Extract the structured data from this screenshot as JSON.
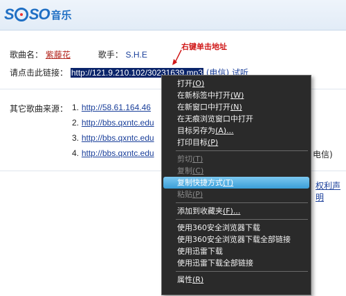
{
  "logo": {
    "brand_left": "S",
    "brand_right": "SO",
    "suffix": "音乐"
  },
  "song": {
    "name_label": "歌曲名：",
    "name": "紫藤花",
    "singer_label": "歌手：",
    "singer": "S.H.E"
  },
  "link": {
    "label": "请点击此链接：",
    "url": "http://121.9.210.102/30231639.mp3",
    "isp": "(电信)",
    "listen": "试听"
  },
  "annotation": "右键单击地址",
  "sources": {
    "label": "其它歌曲来源：",
    "items": [
      {
        "num": "1.",
        "url": "http://58.61.164.46"
      },
      {
        "num": "2.",
        "url": "http://bbs.qxntc.edu"
      },
      {
        "num": "3.",
        "url": "http://bbs.qxntc.edu"
      },
      {
        "num": "4.",
        "url": "http://bbs.qxntc.edu"
      }
    ],
    "tail": "电信)"
  },
  "footer": {
    "rights": "权利声明"
  },
  "context_menu": {
    "items": [
      {
        "label": "打开",
        "key": "(O)",
        "enabled": true
      },
      {
        "label": "在新标签中打开",
        "key": "(W)",
        "enabled": true
      },
      {
        "label": "在新窗口中打开",
        "key": "(N)",
        "enabled": true
      },
      {
        "label": "在无痕浏览窗口中打开",
        "key": "",
        "enabled": true
      },
      {
        "label": "目标另存为",
        "key": "(A)...",
        "enabled": true
      },
      {
        "label": "打印目标",
        "key": "(P)",
        "enabled": true
      },
      {
        "label": "剪切",
        "key": "(T)",
        "enabled": false
      },
      {
        "label": "复制",
        "key": "(C)",
        "enabled": false
      },
      {
        "label": "复制快捷方式",
        "key": "(T)",
        "enabled": true,
        "highlighted": true
      },
      {
        "label": "粘贴",
        "key": "(P)",
        "enabled": false
      },
      {
        "label": "添加到收藏夹",
        "key": "(F)...",
        "enabled": true
      },
      {
        "label": "使用360安全浏览器下载",
        "key": "",
        "enabled": true
      },
      {
        "label": "使用360安全浏览器下载全部链接",
        "key": "",
        "enabled": true
      },
      {
        "label": "使用迅雷下载",
        "key": "",
        "enabled": true
      },
      {
        "label": "使用迅雷下载全部链接",
        "key": "",
        "enabled": true
      },
      {
        "label": "属性",
        "key": "(R)",
        "enabled": true
      }
    ]
  }
}
